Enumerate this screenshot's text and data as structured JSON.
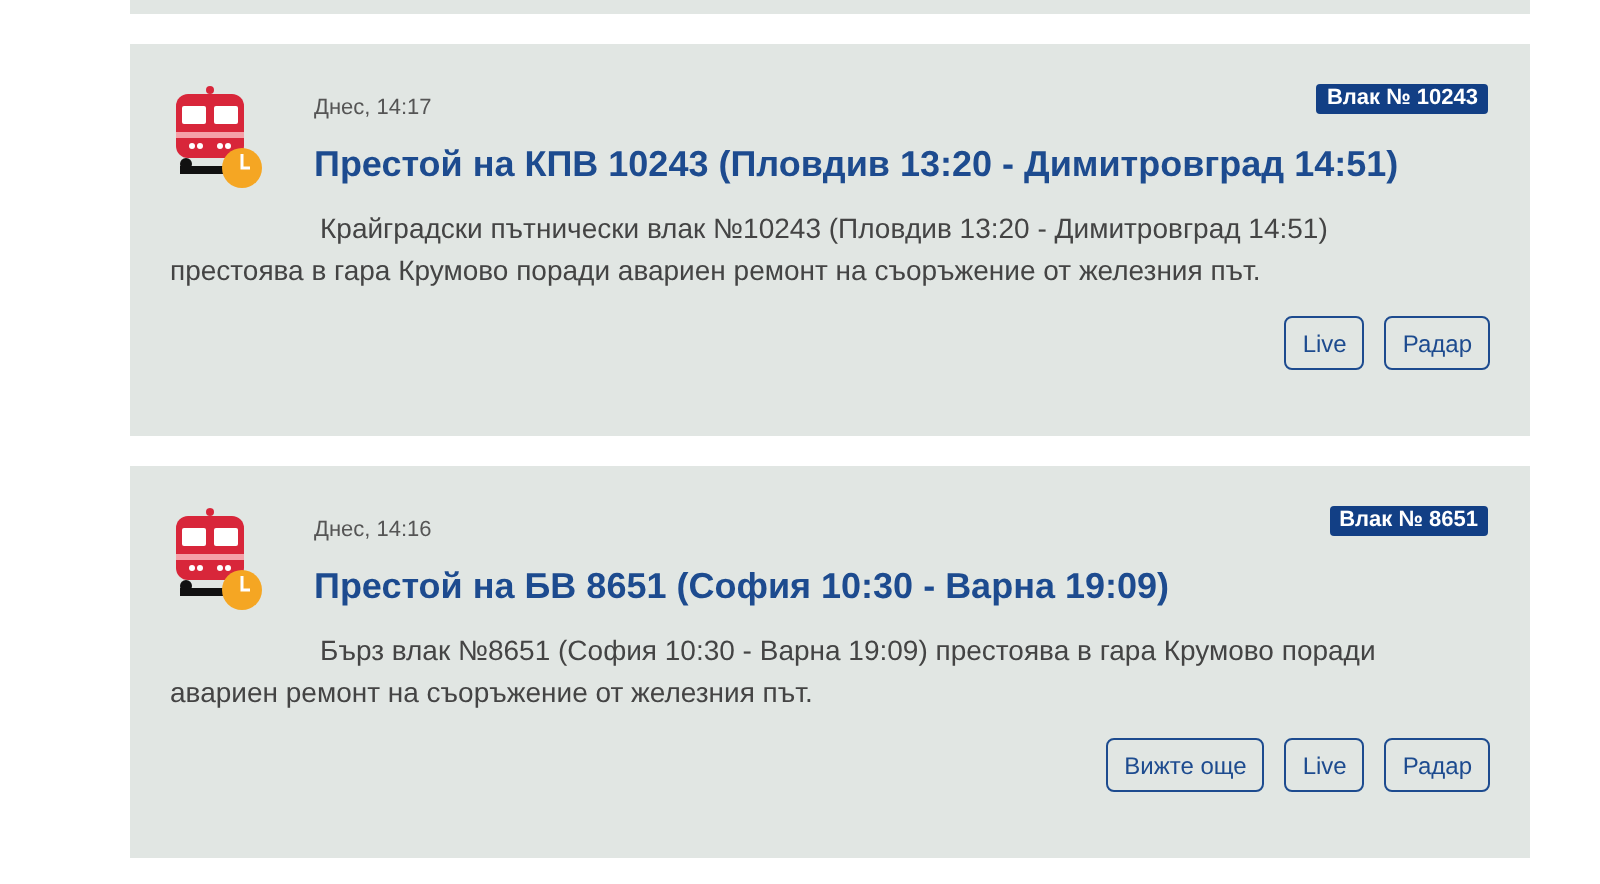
{
  "cards": [
    {
      "time": "Днес, 14:17",
      "badge": "Влак № 10243",
      "title": "Престой на КПВ 10243 (Пловдив 13:20 - Димитровград 14:51)",
      "text": "Крайградски пътнически влак №10243 (Пловдив 13:20 - Димитровград 14:51) престоява в гара Крумово поради авариен ремонт на съоръжение от железния път.",
      "buttons": [
        "Live",
        "Радар"
      ]
    },
    {
      "time": "Днес, 14:16",
      "badge": "Влак № 8651",
      "title": "Престой на БВ 8651 (София 10:30 - Варна 19:09)",
      "text": "Бърз влак №8651 (София 10:30 - Варна 19:09) престоява в гара Крумово поради авариен ремонт на съоръжение от железния път.",
      "buttons": [
        "Вижте още",
        "Live",
        "Радар"
      ]
    }
  ]
}
